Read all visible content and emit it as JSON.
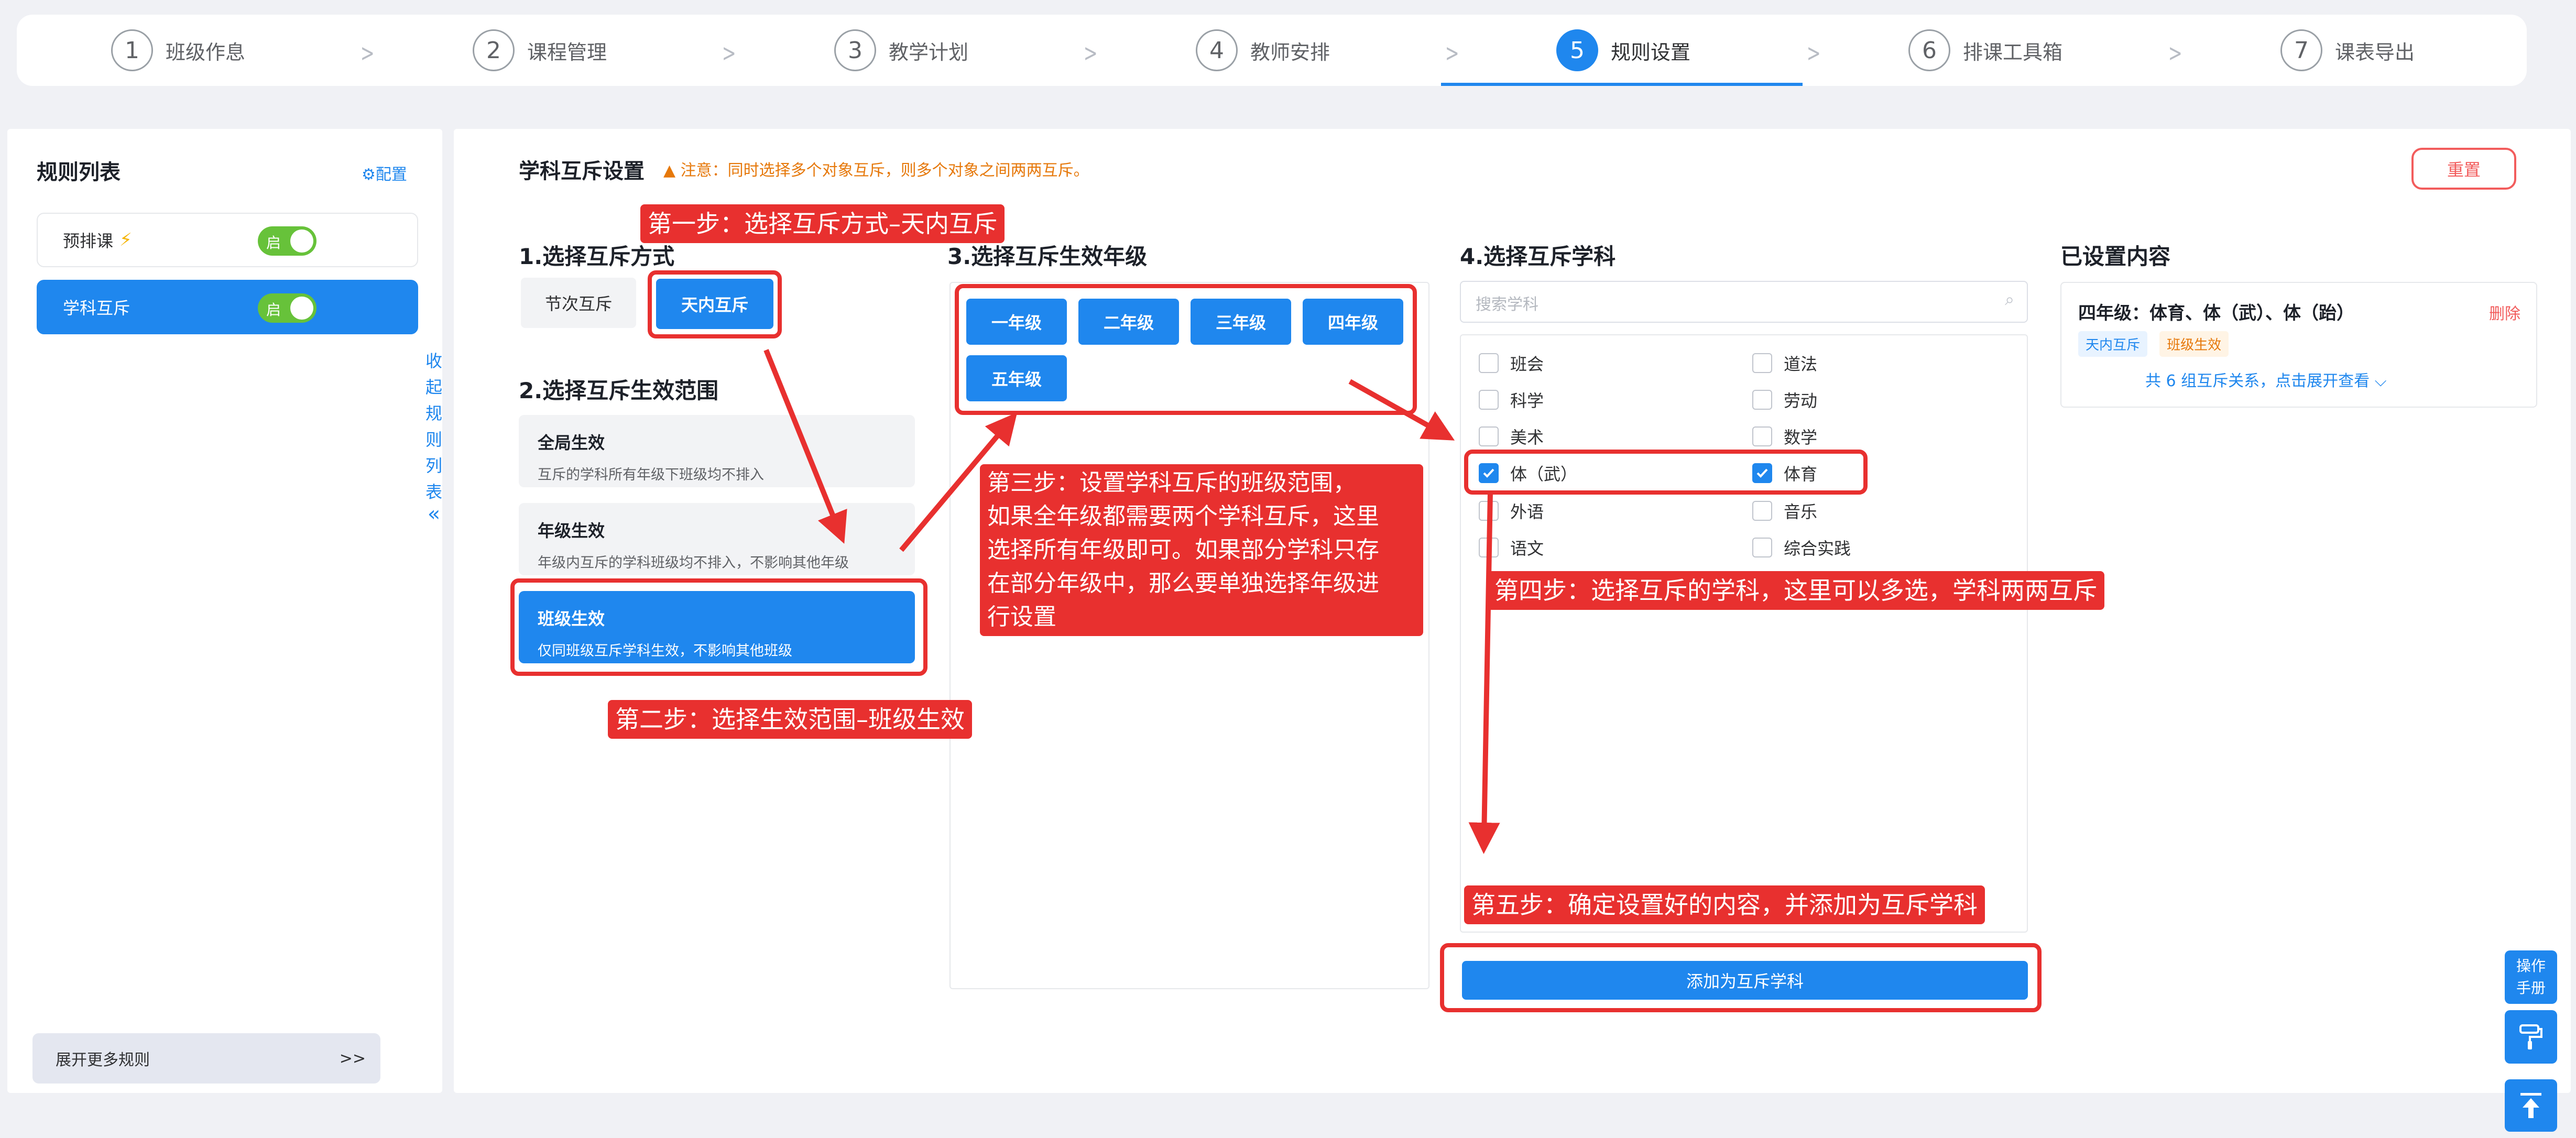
{
  "steps": [
    {
      "num": "1",
      "label": "班级作息"
    },
    {
      "num": "2",
      "label": "课程管理"
    },
    {
      "num": "3",
      "label": "教学计划"
    },
    {
      "num": "4",
      "label": "教师安排"
    },
    {
      "num": "5",
      "label": "规则设置",
      "active": true
    },
    {
      "num": "6",
      "label": "排课工具箱"
    },
    {
      "num": "7",
      "label": "课表导出"
    }
  ],
  "sidebar": {
    "title": "规则列表",
    "config_label": "⚙配置",
    "items": [
      {
        "label": "预排课",
        "toggle": "启"
      },
      {
        "label": "学科互斥",
        "toggle": "启"
      }
    ],
    "collapse_chars": [
      "收",
      "起",
      "规",
      "则",
      "列",
      "表"
    ],
    "collapse_arrow": "«",
    "expand_more": "展开更多规则",
    "expand_arrow": ">>"
  },
  "main": {
    "title": "学科互斥设置",
    "warning": "注意：同时选择多个对象互斥，则多个对象之间两两互斥。",
    "reset_label": "重置",
    "sec1_title": "1.选择互斥方式",
    "mode_options": [
      "节次互斥",
      "天内互斥"
    ],
    "sec2_title": "2.选择互斥生效范围",
    "scopes": [
      {
        "title": "全局生效",
        "desc": "互斥的学科所有年级下班级均不排入"
      },
      {
        "title": "年级生效",
        "desc": "年级内互斥的学科班级均不排入，不影响其他年级"
      },
      {
        "title": "班级生效",
        "desc": "仅同班级互斥学科生效，不影响其他班级"
      }
    ],
    "sec3_title": "3.选择互斥生效年级",
    "grades": [
      "一年级",
      "二年级",
      "三年级",
      "四年级",
      "五年级"
    ],
    "sec4_title": "4.选择互斥学科",
    "search_placeholder": "搜索学科",
    "subjects_left": [
      {
        "label": "班会",
        "checked": false
      },
      {
        "label": "科学",
        "checked": false
      },
      {
        "label": "美术",
        "checked": false
      },
      {
        "label": "体（武）",
        "checked": true
      },
      {
        "label": "外语",
        "checked": false
      },
      {
        "label": "语文",
        "checked": false
      }
    ],
    "subjects_right": [
      {
        "label": "道法",
        "checked": false
      },
      {
        "label": "劳动",
        "checked": false
      },
      {
        "label": "数学",
        "checked": false
      },
      {
        "label": "体育",
        "checked": true
      },
      {
        "label": "音乐",
        "checked": false
      },
      {
        "label": "综合实践",
        "checked": false
      }
    ],
    "add_button": "添加为互斥学科",
    "set_title": "已设置内容",
    "set_item": {
      "title": "四年级：体育、体（武）、体（跆）",
      "delete": "删除",
      "tags": [
        "天内互斥",
        "班级生效"
      ],
      "expand": "共 6 组互斥关系，点击展开查看"
    }
  },
  "annotations": {
    "step1": "第一步：选择互斥方式–天内互斥",
    "step2": "第二步：选择生效范围–班级生效",
    "step3_lines": [
      "第三步：设置学科互斥的班级范围，",
      "如果全年级都需要两个学科互斥，这里",
      "选择所有年级即可。如果部分学科只存",
      "在部分年级中，那么要单独选择年级进",
      "行设置"
    ],
    "step4": "第四步：选择互斥的学科，这里可以多选，学科两两互斥",
    "step5": "第五步：确定设置好的内容，并添加为互斥学科"
  },
  "float_buttons": {
    "manual_line1": "操作",
    "manual_line2": "手册"
  },
  "colors": {
    "primary": "#1f87ee",
    "annotation_red": "#e8302f",
    "toggle_green": "#67c23a",
    "warning_orange": "#e6780a",
    "danger_red": "#f25c5c"
  }
}
